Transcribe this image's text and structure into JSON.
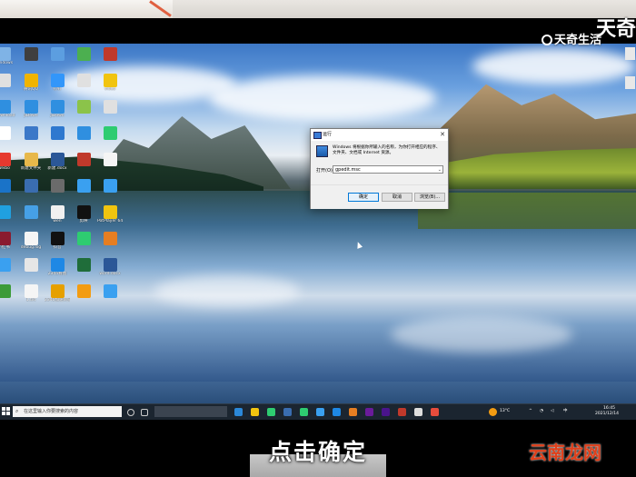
{
  "watermarks": {
    "tianqi": "天奇生活",
    "corner": "天奇",
    "yunnanlong": "云南龙网"
  },
  "subtitle": "点击确定",
  "run_dialog": {
    "title": "运行",
    "close": "✕",
    "description": "Windows 将根据你所输入的名称，为你打开相应的程序、文件夹、文档或 Internet 资源。",
    "open_label": "打开(O):",
    "input_value": "gpedit.msc",
    "ok_label": "确定",
    "cancel_label": "取消",
    "browse_label": "浏览(B)..."
  },
  "taskbar": {
    "search_placeholder": "在这里输入你要搜索的内容",
    "temperature": "13°C",
    "time": "16:45",
    "date": "2021/12/14"
  },
  "desktop_icons": [
    {
      "label": "Windows",
      "color": "#7fb3e6"
    },
    {
      "label": "",
      "color": "#e0e0e0"
    },
    {
      "label": "JiDownload",
      "color": "#2f8fe0"
    },
    {
      "label": "",
      "color": "#ffffff"
    },
    {
      "label": "Weibo",
      "color": "#e6392e"
    },
    {
      "label": "",
      "color": "#1a73c8"
    },
    {
      "label": "",
      "color": "#20a0e0"
    },
    {
      "label": "小红书",
      "color": "#8a1b2f"
    },
    {
      "label": "",
      "color": "#3aa0f0"
    },
    {
      "label": "",
      "color": "#3c9b38"
    },
    {
      "label": "",
      "color": "#3f3f3f"
    },
    {
      "label": "腾讯QQ",
      "color": "#f0b400"
    },
    {
      "label": "JiDown",
      "color": "#2f8fe0"
    },
    {
      "label": "",
      "color": "#3b78c8"
    },
    {
      "label": "新建文件夹",
      "color": "#e8b84a"
    },
    {
      "label": "",
      "color": "#3a6db0"
    },
    {
      "label": "",
      "color": "#46a0e6"
    },
    {
      "label": "debug.log",
      "color": "#f5f5f5"
    },
    {
      "label": "",
      "color": "#e6e6e6"
    },
    {
      "label": "1.txt",
      "color": "#f5f5f5"
    },
    {
      "label": "",
      "color": "#5c9ee0"
    },
    {
      "label": "钉钉",
      "color": "#3296fa"
    },
    {
      "label": "JiDown",
      "color": "#2f8fe0"
    },
    {
      "label": "",
      "color": "#2e78cf"
    },
    {
      "label": "新建.docx",
      "color": "#2b5797"
    },
    {
      "label": "",
      "color": "#6b6b6b"
    },
    {
      "label": "wen",
      "color": "#f0f0f0"
    },
    {
      "label": "抖音",
      "color": "#111111"
    },
    {
      "label": "2345看图",
      "color": "#1e88e5"
    },
    {
      "label": "2345加速浏览器",
      "color": "#e6a000"
    },
    {
      "label": "",
      "color": "#4caf50"
    },
    {
      "label": "",
      "color": "#e0e0e0"
    },
    {
      "label": "",
      "color": "#8bc34a"
    },
    {
      "label": "",
      "color": "#2f8fe0"
    },
    {
      "label": "",
      "color": "#c0392b"
    },
    {
      "label": "",
      "color": "#3aa0f0"
    },
    {
      "label": "剪映",
      "color": "#111111"
    },
    {
      "label": "",
      "color": "#2ecc71"
    },
    {
      "label": "",
      "color": "#1f6d3a"
    },
    {
      "label": "",
      "color": "#f39c12"
    },
    {
      "label": "",
      "color": "#c0392b"
    },
    {
      "label": "video",
      "color": "#f1c40f"
    },
    {
      "label": "",
      "color": "#e0e0e0"
    },
    {
      "label": "",
      "color": "#2ecc71"
    },
    {
      "label": "",
      "color": "#f5f5f5"
    },
    {
      "label": "",
      "color": "#3aa0f0"
    },
    {
      "label": "PotPlayer 64 bit",
      "color": "#f1c40f"
    },
    {
      "label": "",
      "color": "#e67e22"
    },
    {
      "label": "word.docx",
      "color": "#2b5797"
    },
    {
      "label": "",
      "color": "#3aa0f0"
    }
  ]
}
